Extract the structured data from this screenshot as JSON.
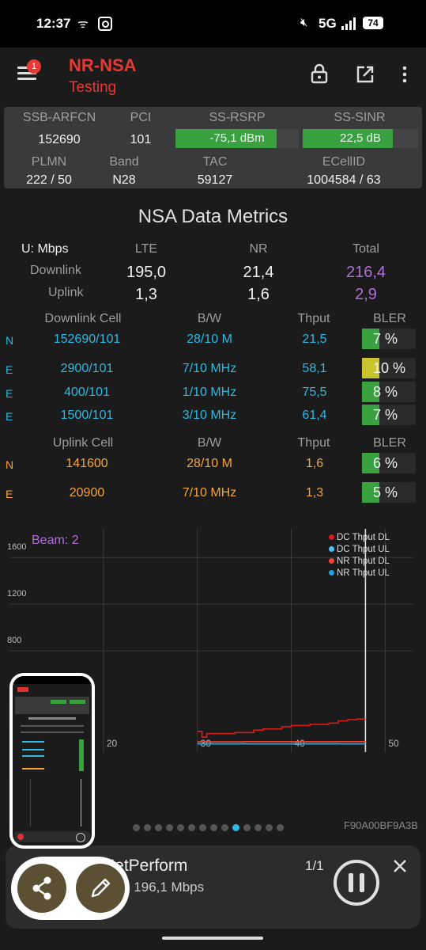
{
  "status_bar": {
    "time": "12:37",
    "network": "5G",
    "battery": "74"
  },
  "app_bar": {
    "badge": "1",
    "title": "NR-NSA",
    "subtitle": "Testing"
  },
  "cell_info": {
    "h1": [
      "SSB-ARFCN",
      "PCI",
      "SS-RSRP",
      "SS-SINR"
    ],
    "v1": {
      "arfcn": "152690",
      "pci": "101",
      "rsrp": "-75,1 dBm",
      "sinr": "22,5 dB"
    },
    "h2": [
      "PLMN",
      "Band",
      "TAC",
      "ECellID"
    ],
    "v2": {
      "plmn": "222 / 50",
      "band": "N28",
      "tac": "59127",
      "ecellid": "1004584 / 63"
    },
    "rsrp_level": 0.82,
    "sinr_level": 0.78
  },
  "metrics": {
    "title": "NSA Data Metrics",
    "unit": "U: Mbps",
    "cols": [
      "LTE",
      "NR",
      "Total"
    ],
    "downlink_label": "Downlink",
    "uplink_label": "Uplink",
    "downlink": {
      "lte": "195,0",
      "nr": "21,4",
      "total": "216,4"
    },
    "uplink": {
      "lte": "1,3",
      "nr": "1,6",
      "total": "2,9"
    }
  },
  "dl_cells": {
    "headers": [
      "Downlink Cell",
      "B/W",
      "Thput",
      "BLER"
    ],
    "rows": [
      {
        "tag": "N",
        "cell": "152690/101",
        "bw": "28/10 M",
        "thput": "21,5",
        "bler": "7 %"
      },
      {
        "tag": "E",
        "cell": "2900/101",
        "bw": "7/10 MHz",
        "thput": "58,1",
        "bler": "10 %"
      },
      {
        "tag": "E",
        "cell": "400/101",
        "bw": "1/10 MHz",
        "thput": "75,5",
        "bler": "8 %"
      },
      {
        "tag": "E",
        "cell": "1500/101",
        "bw": "3/10 MHz",
        "thput": "61,4",
        "bler": "7 %"
      }
    ]
  },
  "ul_cells": {
    "headers": [
      "Uplink Cell",
      "B/W",
      "Thput",
      "BLER"
    ],
    "rows": [
      {
        "tag": "N",
        "cell": "141600",
        "bw": "28/10 M",
        "thput": "1,6",
        "bler": "6 %"
      },
      {
        "tag": "E",
        "cell": "20900",
        "bw": "7/10 MHz",
        "thput": "1,3",
        "bler": "5 %"
      }
    ]
  },
  "chart_data": {
    "type": "line",
    "annotation": "Beam: 2",
    "y_ticks": [
      "1600",
      "1200",
      "800"
    ],
    "x_ticks": [
      "20",
      "30",
      "40",
      "50"
    ],
    "ylim": [
      0,
      1900
    ],
    "xlim": [
      10,
      53
    ],
    "series": [
      {
        "name": "DC Thput DL",
        "color": "#d81b1b",
        "x": [
          30,
          30.5,
          31,
          32,
          33,
          34,
          35,
          36,
          37,
          38,
          39,
          40,
          41,
          42,
          43,
          44,
          45,
          46,
          47,
          47.9
        ],
        "y": [
          110,
          60,
          90,
          90,
          90,
          100,
          100,
          120,
          130,
          130,
          150,
          160,
          160,
          170,
          170,
          180,
          200,
          210,
          215,
          215
        ]
      },
      {
        "name": "DC Thput UL",
        "color": "#4fc3f7",
        "x": [
          30,
          47.9
        ],
        "y": [
          3,
          3
        ]
      },
      {
        "name": "NR Thput DL",
        "color": "#f44336",
        "x": [
          30,
          35,
          40,
          45,
          47.9
        ],
        "y": [
          20,
          22,
          21,
          22,
          21
        ]
      },
      {
        "name": "NR Thput UL",
        "color": "#29a0d8",
        "x": [
          30,
          47.9
        ],
        "y": [
          2,
          2
        ]
      }
    ]
  },
  "page_indicator": {
    "count": 14,
    "active": 9
  },
  "device_id": "F90A00BF9A3B",
  "notification": {
    "app": "NetPerform",
    "text": "20) 196,1 Mbps",
    "counter": "1/1"
  }
}
